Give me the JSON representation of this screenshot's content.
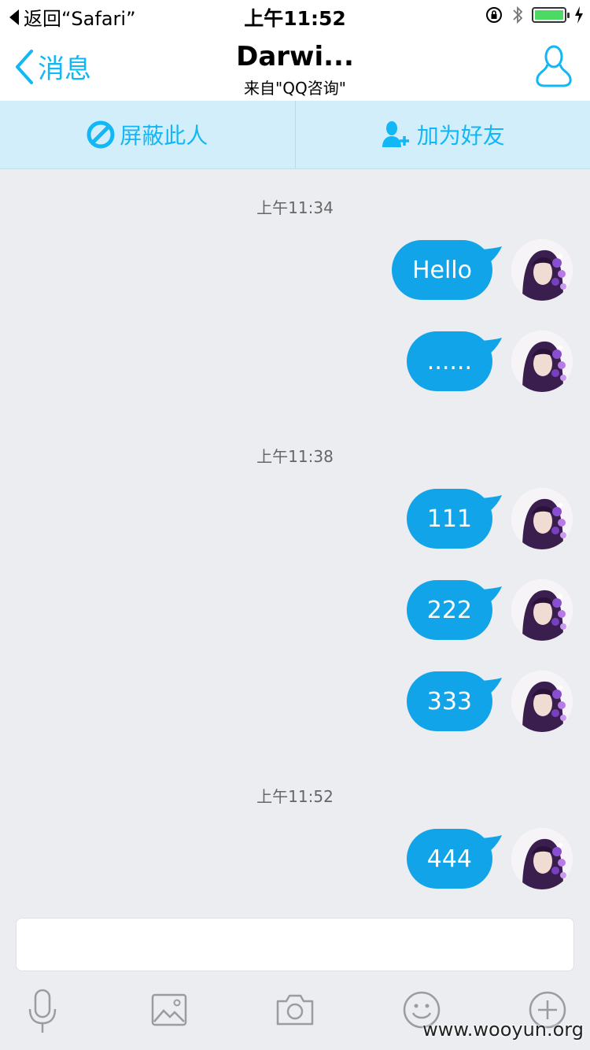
{
  "status_bar": {
    "back_app": "返回“Safari”",
    "time": "上午11:52"
  },
  "nav": {
    "back_label": "消息",
    "title": "Darwi...",
    "subtitle": "来自\"QQ咨询\""
  },
  "actions": {
    "block_label": "屏蔽此人",
    "add_friend_label": "加为好友"
  },
  "messages": [
    {
      "timestamp": "上午11:34"
    },
    {
      "text": "Hello"
    },
    {
      "text": "......"
    },
    {
      "timestamp": "上午11:38"
    },
    {
      "text": "111"
    },
    {
      "text": "222"
    },
    {
      "text": "333"
    },
    {
      "timestamp": "上午11:52"
    },
    {
      "text": "444"
    }
  ],
  "input": {
    "placeholder": ""
  },
  "toolbar": {
    "icons": [
      "microphone-icon",
      "image-icon",
      "camera-icon",
      "emoji-icon",
      "plus-icon"
    ]
  },
  "watermark": "www.wooyun.org",
  "colors": {
    "accent": "#12b7f5",
    "bubble": "#12a4e8",
    "action_bar": "#d3eefb",
    "background": "#ebedf1",
    "battery": "#4cd964"
  }
}
